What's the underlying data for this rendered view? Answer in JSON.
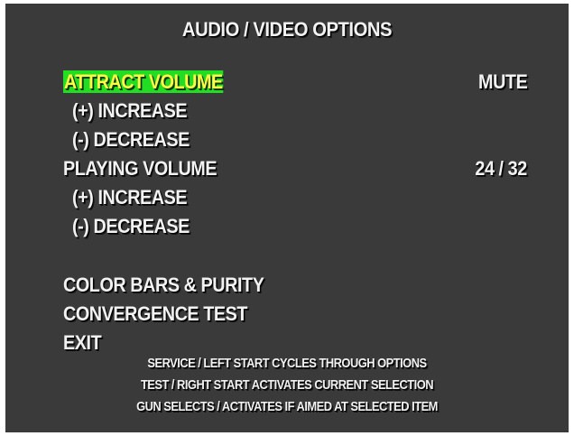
{
  "title": "AUDIO / VIDEO OPTIONS",
  "colors": {
    "background": "#3a3a3a",
    "text": "#f2f2f2",
    "highlight_bg": "#22dd22",
    "highlight_text": "#ffff44"
  },
  "menu": {
    "attract_volume": {
      "label": "ATTRACT VOLUME",
      "value": "MUTE",
      "selected": true
    },
    "attract_increase": "(+) INCREASE",
    "attract_decrease": "(-) DECREASE",
    "playing_volume": {
      "label": "PLAYING VOLUME",
      "value": "24 / 32"
    },
    "playing_increase": "(+) INCREASE",
    "playing_decrease": "(-) DECREASE",
    "color_bars": "COLOR BARS & PURITY",
    "convergence": "CONVERGENCE TEST",
    "exit": "EXIT"
  },
  "help": [
    "SERVICE / LEFT START CYCLES THROUGH OPTIONS",
    "TEST / RIGHT START ACTIVATES CURRENT SELECTION",
    "GUN SELECTS / ACTIVATES IF AIMED AT SELECTED ITEM"
  ]
}
